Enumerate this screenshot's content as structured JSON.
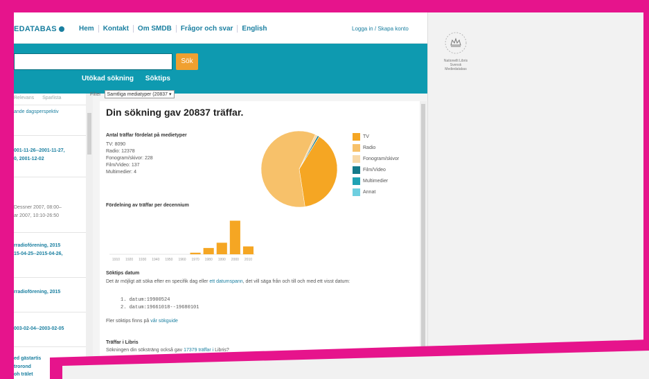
{
  "header": {
    "logo_text": "EDATABAS",
    "nav": [
      "Hem",
      "Kontakt",
      "Om SMDB",
      "Frågor och svar",
      "English"
    ],
    "login": "Logga in / Skapa konto"
  },
  "search": {
    "button_label": "Sök",
    "links": [
      "Utökad sökning",
      "Söktips"
    ]
  },
  "filter": {
    "label": "Filter",
    "selected": "Samtliga mediatyper (20837"
  },
  "left_results": {
    "tabs": [
      "Relevans",
      "Sparlista"
    ],
    "items": [
      {
        "text": "ande dagsperspektiv",
        "style": "normal"
      },
      {
        "text": "001-11-26--2001-11-27,",
        "style": "bold"
      },
      {
        "text": "0, 2001-12-02",
        "style": "bold"
      },
      {
        "text": "Dessner 2007, 08:00–",
        "style": "grey"
      },
      {
        "text": "ar 2007, 10:10-26:50",
        "style": "grey"
      },
      {
        "text": "rradiofórening, 2015",
        "style": "bold"
      },
      {
        "text": "15-04-25--2015-04-26,",
        "style": "bold"
      },
      {
        "text": "rradioförening, 2015",
        "style": "bold"
      },
      {
        "text": "003-02-04--2003-02-05",
        "style": "bold"
      },
      {
        "text": "ed gästartis",
        "style": "bold"
      },
      {
        "text": "trorond",
        "style": "bold"
      },
      {
        "text": "oh trälet",
        "style": "bold"
      }
    ]
  },
  "main": {
    "title": "Din sökning gav 20837 träffar.",
    "stats_heading": "Antal träffar fördelat på medietyper",
    "stats": [
      "TV: 8090",
      "Radio: 12378",
      "Fonogram/skivor: 228",
      "Film/Video: 137",
      "Multimedier: 4"
    ],
    "legend": [
      {
        "label": "TV",
        "color": "#f5a623"
      },
      {
        "label": "Radio",
        "color": "#f7c16a"
      },
      {
        "label": "Fonogram/skivor",
        "color": "#f8d9a8"
      },
      {
        "label": "Film/Video",
        "color": "#157a8a"
      },
      {
        "label": "Multimedier",
        "color": "#1fa2b4"
      },
      {
        "label": "Annat",
        "color": "#6ecfe0"
      }
    ],
    "decade_heading": "Fördelning av träffar per decennium",
    "soktips_heading": "Söktips datum",
    "soktips_text_1": "Det är möjligt att söka efter en specifik dag eller ",
    "soktips_link": "ett datumspann",
    "soktips_text_2": ", det vill säga från och till och med ett visst datum:",
    "examples": [
      "1. datum:19900524",
      "2. datum:19661018--19680101"
    ],
    "more_tips_prefix": "Fler söktips finns på ",
    "more_tips_link": "vår sökguide",
    "libris_heading": "Träffar i Libris",
    "libris_prefix": "Sökningen din söksträng också gav ",
    "libris_link": "17379 träffar i",
    "libris_suffix": " Libris?"
  },
  "right_panel": {
    "caption_line1": "Nationellt Libris",
    "caption_line2": "Svensk Mediedatabas"
  },
  "chart_data": [
    {
      "type": "pie",
      "title": "",
      "categories": [
        "TV",
        "Radio",
        "Fonogram/skivor",
        "Film/Video",
        "Multimedier",
        "Annat"
      ],
      "values": [
        8090,
        12378,
        228,
        137,
        4,
        0
      ]
    },
    {
      "type": "bar",
      "title": "Fördelning av träffar per decennium",
      "categories": [
        "1910",
        "1920",
        "1930",
        "1940",
        "1950",
        "1960",
        "1970",
        "1980",
        "1990",
        "2000",
        "2010"
      ],
      "values": [
        0,
        0,
        0,
        0,
        0,
        0,
        150,
        600,
        1100,
        3200,
        750
      ],
      "ylim": [
        0,
        3300
      ]
    }
  ]
}
